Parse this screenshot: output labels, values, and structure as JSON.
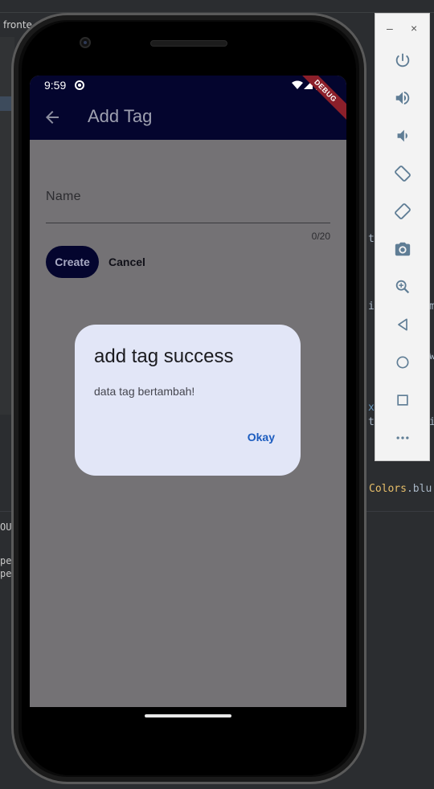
{
  "ide": {
    "tab_label": "fronte",
    "code_fragment_class": "Colors",
    "code_fragment_member": ".blu",
    "snippets": [
      "t",
      "i",
      "m",
      "w",
      "x",
      "t",
      "i"
    ],
    "bottom_lines": [
      "OU",
      "pe",
      "pe"
    ]
  },
  "status_bar": {
    "time": "9:59",
    "debug_label": "DEBUG"
  },
  "appbar": {
    "title": "Add Tag"
  },
  "form": {
    "name_label": "Name",
    "counter": "0/20",
    "create_label": "Create",
    "cancel_label": "Cancel"
  },
  "dialog": {
    "title": "add tag success",
    "body": "data tag bertambah!",
    "okay_label": "Okay"
  },
  "emulator_toolbar": {
    "minimize_label": "–",
    "close_label": "×",
    "buttons": [
      "power-icon",
      "volume-up-icon",
      "volume-down-icon",
      "rotate-left-icon",
      "rotate-right-icon",
      "screenshot-icon",
      "zoom-icon",
      "back-icon",
      "home-icon",
      "overview-icon",
      "more-icon"
    ]
  },
  "colors": {
    "appbar": "#04052e",
    "scrim": "#747275",
    "dialog": "#e2e6f7",
    "accent": "#1c5cbf"
  }
}
